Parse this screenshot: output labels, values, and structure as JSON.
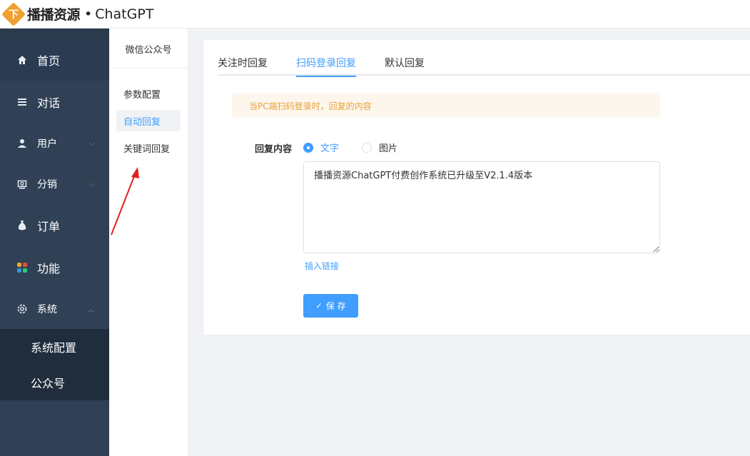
{
  "header": {
    "brand": "播播资源",
    "separator": "•",
    "product": "ChatGPT",
    "logo_glyph": "下"
  },
  "sidebar": {
    "items": [
      {
        "label": "首页",
        "icon": "home-icon"
      },
      {
        "label": "对话",
        "icon": "menu-lines-icon"
      },
      {
        "label": "用户",
        "icon": "user-icon",
        "expandable": true
      },
      {
        "label": "分销",
        "icon": "share-box-icon",
        "expandable": true
      },
      {
        "label": "订单",
        "icon": "money-bag-icon"
      },
      {
        "label": "功能",
        "icon": "apps-grid-icon"
      },
      {
        "label": "系统",
        "icon": "gear-icon",
        "expandable": true,
        "expanded": true
      }
    ],
    "submenu": [
      {
        "label": "系统配置"
      },
      {
        "label": "公众号"
      }
    ]
  },
  "subnav": {
    "title": "微信公众号",
    "items": [
      {
        "label": "参数配置"
      },
      {
        "label": "自动回复",
        "active": true
      },
      {
        "label": "关键词回复"
      }
    ]
  },
  "tabs": [
    {
      "label": "关注时回复"
    },
    {
      "label": "扫码登录回复",
      "active": true
    },
    {
      "label": "默认回复"
    }
  ],
  "alert": {
    "text": "当PC端扫码登录时，回复的内容"
  },
  "form": {
    "label": "回复内容",
    "options": [
      {
        "label": "文字",
        "checked": true
      },
      {
        "label": "图片",
        "checked": false
      }
    ],
    "content": "播播资源ChatGPT付费创作系统已升级至V2.1.4版本",
    "insert_link": "插入链接",
    "save": "保 存"
  },
  "colors": {
    "primary": "#409eff",
    "sidebar_bg": "#304156",
    "submenu_bg": "#1f2d3d",
    "alert_bg": "#fdf6ec",
    "alert_text": "#e6a23c",
    "logo": "#f0a030",
    "annotation": "#e02020"
  }
}
